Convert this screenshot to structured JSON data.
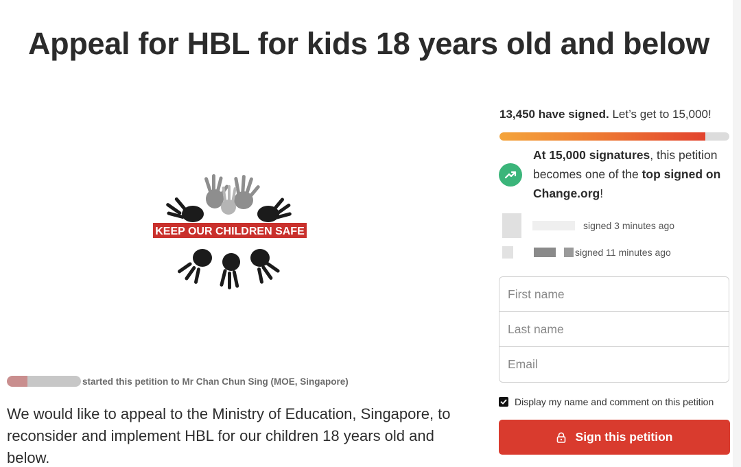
{
  "petition": {
    "title": "Appeal for HBL for kids 18 years old and below",
    "hero_image_caption": "KEEP OUR CHILDREN SAFE",
    "starter_line": "started this petition to Mr Chan Chun Sing (MOE, Singapore)",
    "description": "We would like to appeal to the Ministry of Education, Singapore, to reconsider and implement HBL for our children 18 years old and below."
  },
  "progress": {
    "signed_count": "13,450 have signed.",
    "goal_text": "Let’s get to 15,000!",
    "signed": 13450,
    "goal": 15000,
    "fill_colors": [
      "#f4a43b",
      "#ee7d33",
      "#e2432e"
    ]
  },
  "milestone": {
    "icon": "trending-up-icon",
    "bold_count": "At 15,000 signatures",
    "middle": ", this petition becomes one of the ",
    "bold_tail": "top signed on Change.org",
    "end": "!"
  },
  "recent_signers": [
    {
      "time": "signed 3 minutes ago"
    },
    {
      "time": "signed 11 minutes ago"
    }
  ],
  "form": {
    "first_name_placeholder": "First name",
    "last_name_placeholder": "Last name",
    "email_placeholder": "Email",
    "consent_label": "Display my name and comment on this petition",
    "consent_checked": true,
    "submit_label": "Sign this petition",
    "submit_color": "#d93b2e"
  }
}
